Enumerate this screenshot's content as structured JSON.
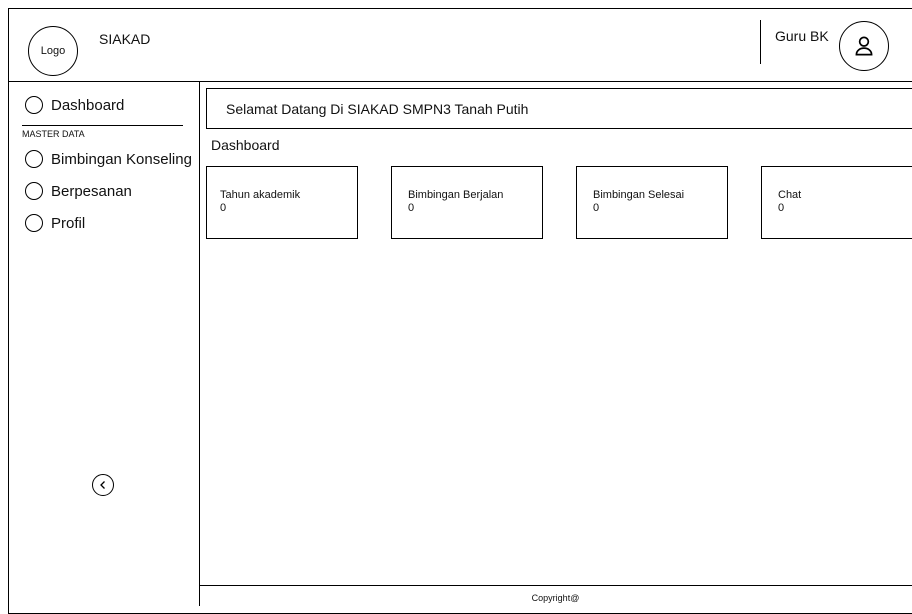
{
  "header": {
    "logo": "Logo",
    "app_title": "SIAKAD",
    "user_name": "Guru BK",
    "avatar_icon": "user-icon"
  },
  "sidebar": {
    "items": [
      {
        "label": "Dashboard"
      },
      {
        "label": "Bimbingan Konseling"
      },
      {
        "label": "Berpesanan"
      },
      {
        "label": "Profil"
      }
    ],
    "section_label": "MASTER DATA",
    "collapse_icon": "chevron-left-icon"
  },
  "main": {
    "welcome": "Selamat Datang Di SIAKAD SMPN3 Tanah Putih",
    "page_title": "Dashboard",
    "cards": [
      {
        "label": "Tahun akademik",
        "value": "0"
      },
      {
        "label": "Bimbingan Berjalan",
        "value": "0"
      },
      {
        "label": "Bimbingan Selesai",
        "value": "0"
      },
      {
        "label": "Chat",
        "value": "0"
      }
    ]
  },
  "footer": {
    "text": "Copyright@"
  }
}
